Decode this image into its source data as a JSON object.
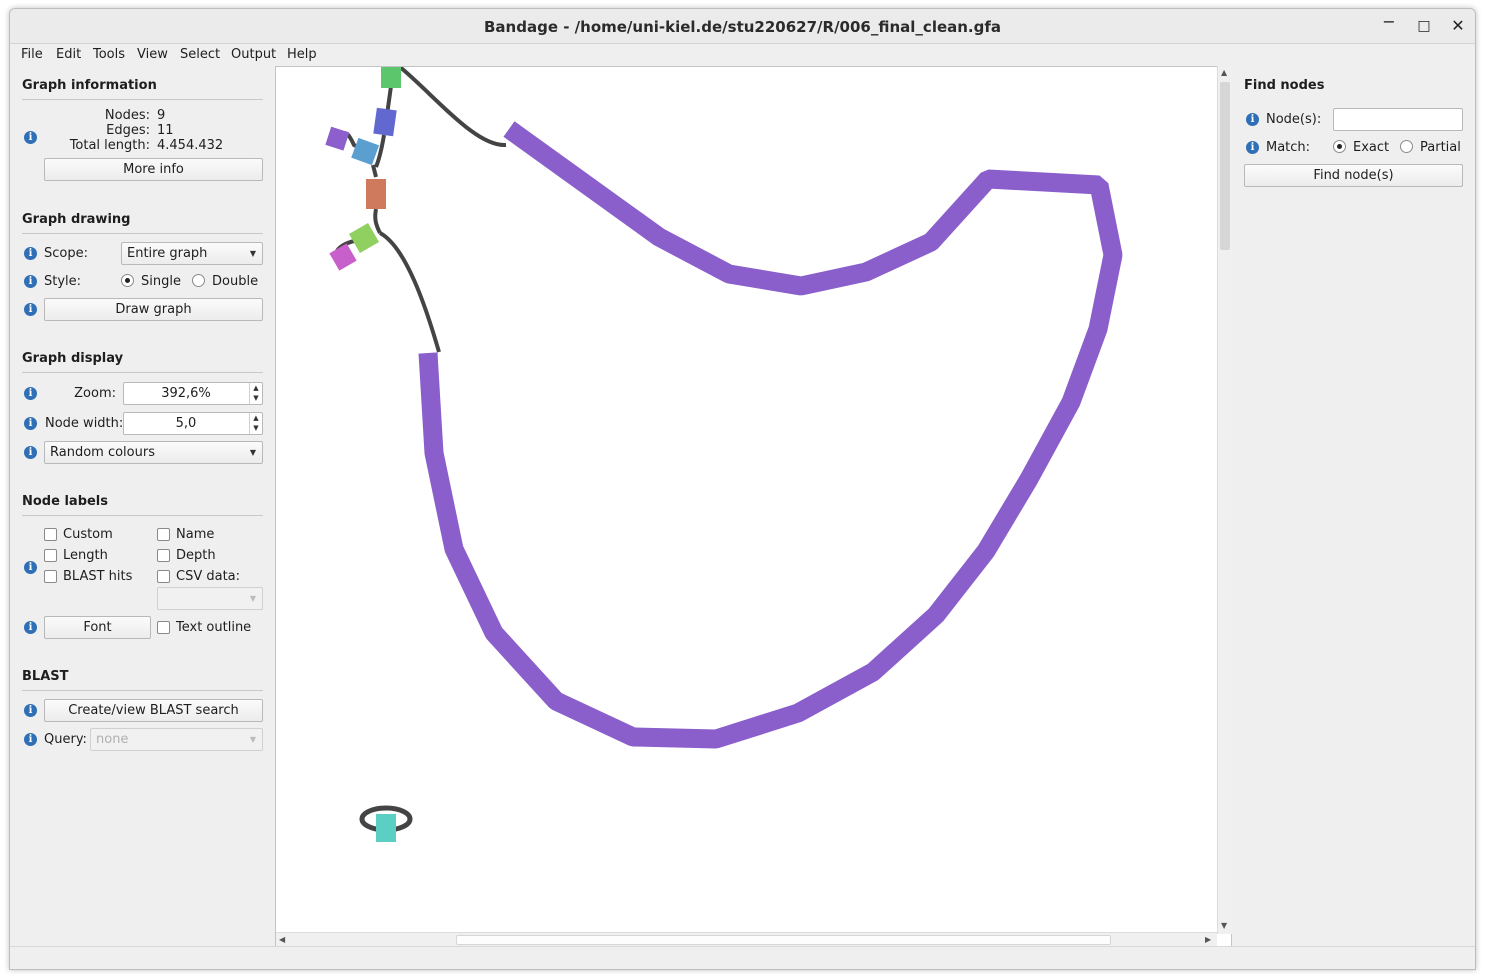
{
  "window": {
    "title": "Bandage - /home/uni-kiel.de/stu220627/R/006_final_clean.gfa",
    "controls": {
      "minimize": "−",
      "maximize": "□",
      "close": "✕"
    }
  },
  "menu": [
    "File",
    "Edit",
    "Tools",
    "View",
    "Select",
    "Output",
    "Help"
  ],
  "graph_information": {
    "title": "Graph information",
    "nodes_label": "Nodes:",
    "nodes_value": "9",
    "edges_label": "Edges:",
    "edges_value": "11",
    "length_label": "Total length:",
    "length_value": "4.454.432",
    "more_info_button": "More info"
  },
  "graph_drawing": {
    "title": "Graph drawing",
    "scope_label": "Scope:",
    "scope_value": "Entire graph",
    "style_label": "Style:",
    "style_single": "Single",
    "style_double": "Double",
    "style_selected": "Single",
    "draw_button": "Draw graph"
  },
  "graph_display": {
    "title": "Graph display",
    "zoom_label": "Zoom:",
    "zoom_value": "392,6%",
    "node_width_label": "Node width:",
    "node_width_value": "5,0",
    "colour_scheme": "Random colours"
  },
  "node_labels": {
    "title": "Node labels",
    "custom": "Custom",
    "name": "Name",
    "length": "Length",
    "depth": "Depth",
    "blast_hits": "BLAST hits",
    "csv_data": "CSV data:",
    "csv_value": "",
    "font_button": "Font",
    "text_outline": "Text outline"
  },
  "blast": {
    "title": "BLAST",
    "create_button": "Create/view BLAST search",
    "query_label": "Query:",
    "query_value": "none"
  },
  "find_nodes": {
    "title": "Find nodes",
    "nodes_label": "Node(s):",
    "nodes_value": "",
    "match_label": "Match:",
    "exact": "Exact",
    "partial": "Partial",
    "match_selected": "Exact",
    "find_button": "Find node(s)"
  },
  "graph": {
    "edge_color": "#444444",
    "long_node_color": "#8a5fcc",
    "node_colors": {
      "green": "#5cc66c",
      "blue": "#6168cf",
      "purple": "#8c5fcc",
      "light_blue": "#5b9fd0",
      "orange": "#cf7a5c",
      "lime": "#90d060",
      "magenta": "#c860cc",
      "teal": "#5ccfc4"
    }
  }
}
